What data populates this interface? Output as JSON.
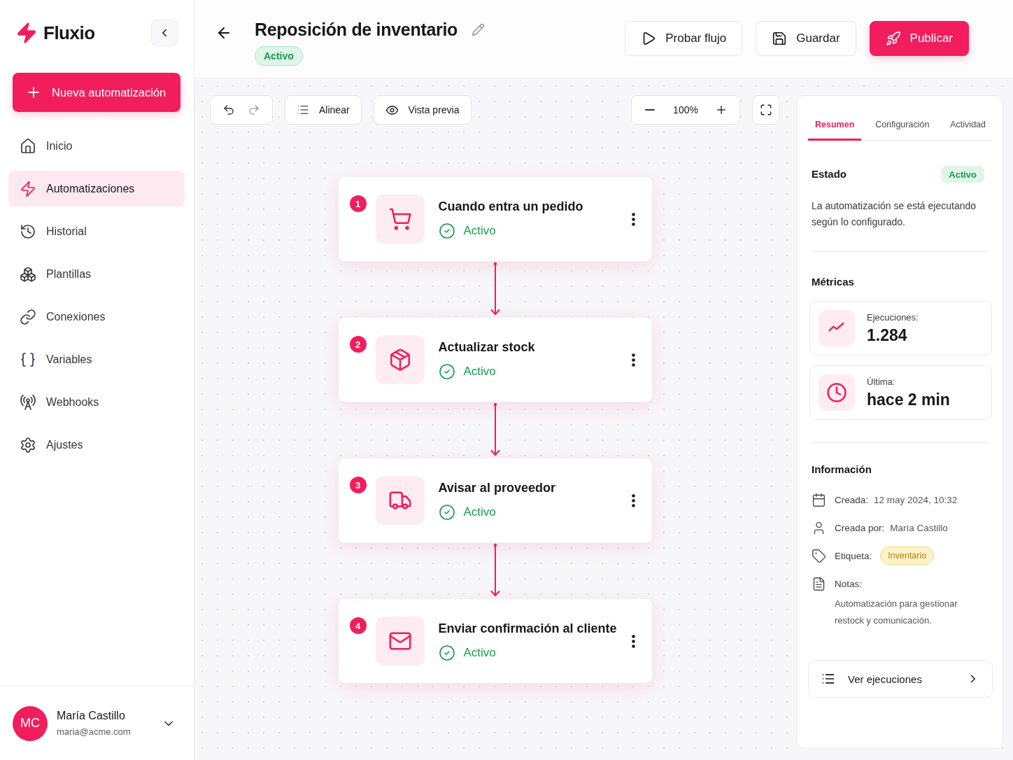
{
  "sidebar": {
    "logo": "Fluxio",
    "new_button": "Nueva automatización",
    "items": [
      {
        "label": "Inicio",
        "selected": false
      },
      {
        "label": "Automatizaciones",
        "selected": true
      },
      {
        "label": "Historial",
        "selected": false
      },
      {
        "label": "Plantillas",
        "selected": false
      },
      {
        "label": "Conexiones",
        "selected": false
      },
      {
        "label": "Variables",
        "selected": false
      },
      {
        "label": "Webhooks",
        "selected": false
      },
      {
        "label": "Ajustes",
        "selected": false
      }
    ],
    "user": {
      "initials": "MC",
      "name": "María Castillo",
      "email": "maria@acme.com"
    }
  },
  "header": {
    "title": "Reposición de inventario",
    "status": "Activo",
    "buttons": [
      {
        "label": "Probar flujo",
        "kind": "outline"
      },
      {
        "label": "Guardar",
        "kind": "outline"
      },
      {
        "label": "Publicar",
        "kind": "primary"
      }
    ]
  },
  "toolbar": {
    "align_button": "Alinear",
    "preview_button": "Vista previa",
    "zoom": "100%"
  },
  "flow": {
    "steps": [
      {
        "number": "1",
        "title": "Cuando entra un pedido",
        "status": "Activo"
      },
      {
        "number": "2",
        "title": "Actualizar stock",
        "status": "Activo"
      },
      {
        "number": "3",
        "title": "Avisar al proveedor",
        "status": "Activo"
      },
      {
        "number": "4",
        "title": "Enviar confirmación al cliente",
        "status": "Activo"
      }
    ]
  },
  "panel": {
    "tabs": [
      {
        "label": "Resumen",
        "selected": true
      },
      {
        "label": "Configuración",
        "selected": false
      },
      {
        "label": "Actividad",
        "selected": false
      }
    ],
    "status": {
      "heading": "Estado",
      "badge": "Activo",
      "description": "La automatización se está ejecutando según lo configurado."
    },
    "metrics": {
      "heading": "Métricas",
      "items": [
        {
          "label": "Ejecuciones:",
          "value": "1.284"
        },
        {
          "label": "Última:",
          "value": "hace 2 min"
        }
      ]
    },
    "info": {
      "heading": "Información",
      "rows": [
        {
          "kind": "text",
          "label": "Creada:",
          "value": "12 may 2024, 10:32"
        },
        {
          "kind": "text",
          "label": "Creada por:",
          "value": "María Castillo"
        },
        {
          "kind": "tag",
          "label": "Etiqueta:",
          "value": "Inventario"
        },
        {
          "kind": "note",
          "label": "Notas:",
          "value": "Automatización para gestionar restock y comunicación."
        }
      ]
    },
    "footer_button": "Ver ejecuciones"
  }
}
